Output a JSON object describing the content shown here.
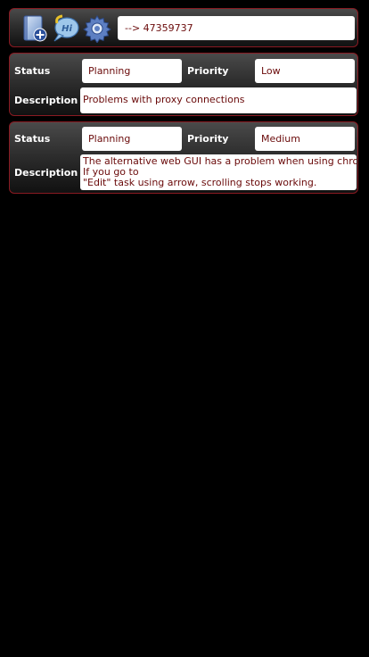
{
  "toolbar": {
    "icons": [
      "new-task-icon",
      "chat-icon",
      "gear-icon"
    ],
    "search_value": "--> 47359737"
  },
  "labels": {
    "status": "Status",
    "priority": "Priority",
    "description": "Description"
  },
  "tasks": [
    {
      "status": "Planning",
      "priority": "Low",
      "description_lines": [
        "Problems with proxy connections"
      ]
    },
    {
      "status": "Planning",
      "priority": "Medium",
      "description_lines": [
        "The alternative web GUI has a problem when using chrome.",
        "If you go to",
        "\"Edit\" task using arrow, scrolling stops working."
      ]
    }
  ],
  "colors": {
    "panel_border": "#8a1a22",
    "field_text": "#6a0a0a"
  }
}
